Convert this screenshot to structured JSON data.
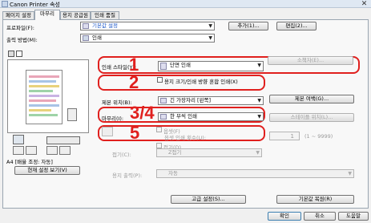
{
  "window": {
    "title": "Canon Printer 속성"
  },
  "tabs": [
    {
      "label": "페이지 설정"
    },
    {
      "label": "마무리"
    },
    {
      "label": "용지 공급원"
    },
    {
      "label": "인쇄 품질"
    }
  ],
  "profile": {
    "label": "프로파일(F):",
    "value": "기본값 설정",
    "add_button": "추가(1)...",
    "edit_button": "편집(2)..."
  },
  "output_method": {
    "label": "출력 방법(M):",
    "value": "인쇄"
  },
  "preview": {
    "paper_label": "A4 [배율 조정: 자동]",
    "view_settings_button": "현재 설정 보기(V)"
  },
  "print_style": {
    "label": "인쇄 스타일(Y):",
    "value": "단면 인쇄",
    "booklet_button": "소책자(E)..."
  },
  "mixed_paper": {
    "label": "용지 크기/인쇄 방향 혼합 인쇄(X)"
  },
  "binding": {
    "label": "제본 위치(B):",
    "value": "긴 가장자리 [왼쪽]",
    "margin_button": "제본 여백(G)..."
  },
  "finishing": {
    "label": "마무리(I):",
    "value": "한 부씩 인쇄",
    "staple_button": "스테이플 위치(L)..."
  },
  "offset": {
    "checkbox_label": "옵셋(F)",
    "count_label": "옵셋 인쇄 횟수(U):",
    "count_value": "1",
    "range": "(1 ~ 9999)"
  },
  "fold": {
    "checkbox_label": "접기(D)"
  },
  "tri_fold": {
    "label": "접기(C):",
    "value": "Z접기"
  },
  "paper_output": {
    "label": "용지 출력(P):",
    "value": "자동"
  },
  "advanced_button": "고급 설정(S)...",
  "restore_button": "기본값 복원(R)",
  "footer": {
    "ok": "확인",
    "cancel": "취소",
    "help": "도움말"
  },
  "callouts": [
    "1",
    "2",
    "3/4",
    "5"
  ],
  "colors": {
    "callout_red": "#e0201e"
  }
}
